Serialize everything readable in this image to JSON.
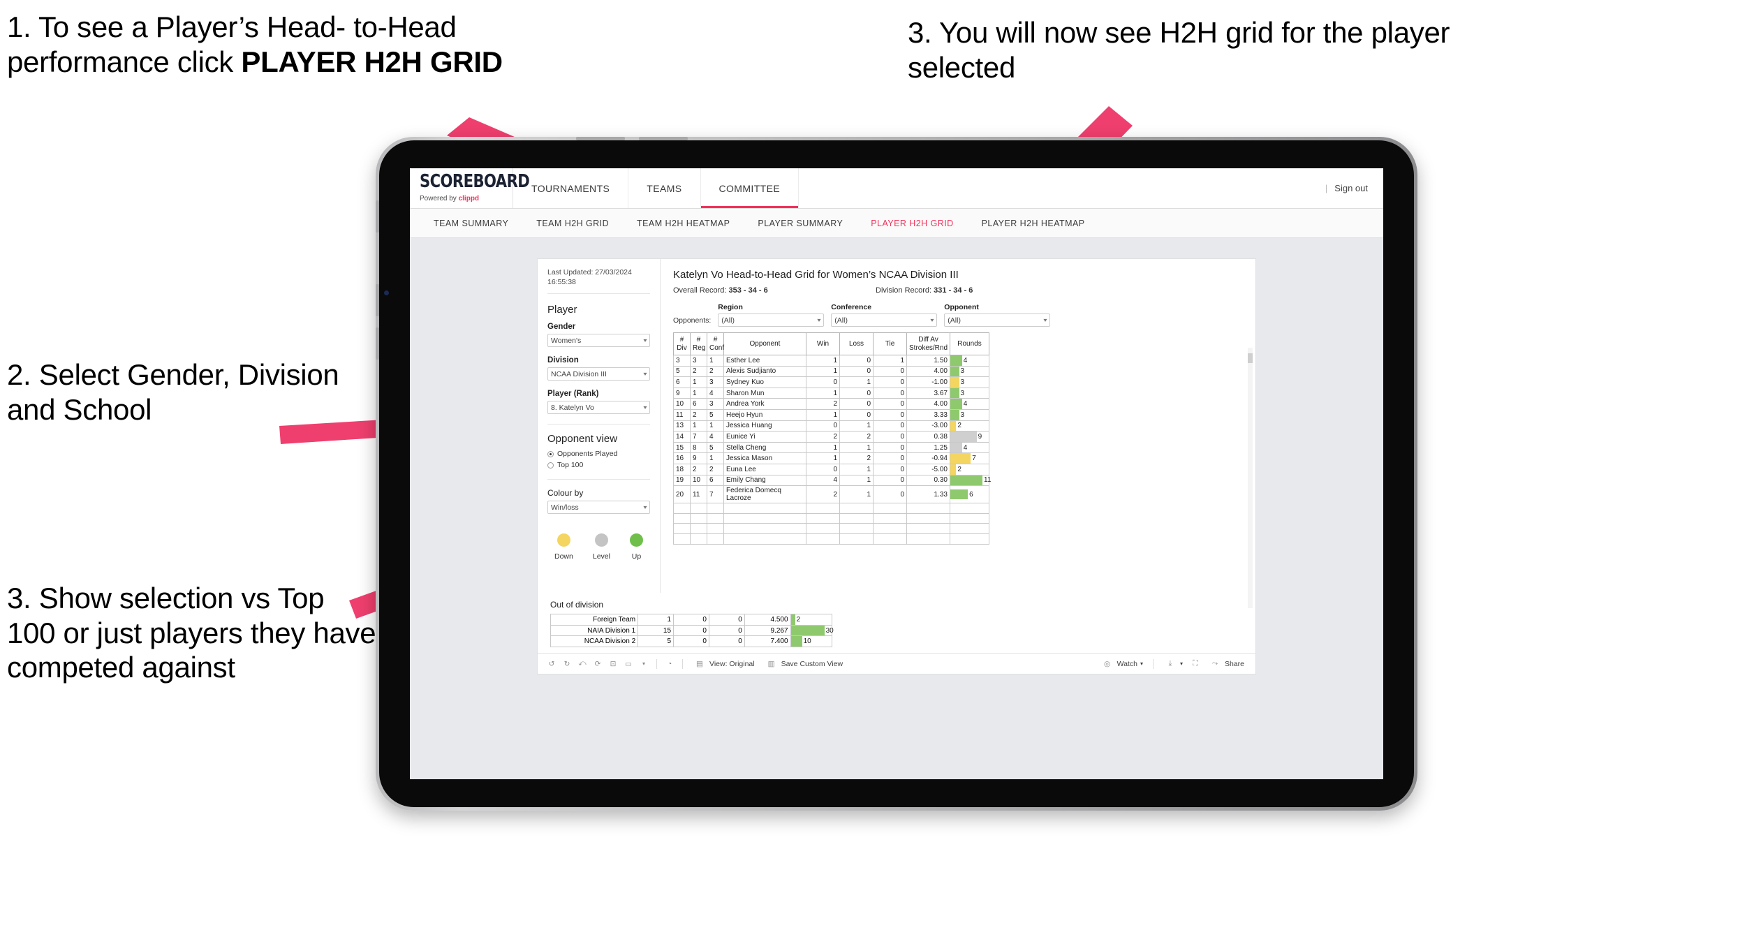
{
  "annotations": {
    "a1_line1": "1. To see a Player’s Head-",
    "a1_line2": "to-Head performance click",
    "a1_bold": "PLAYER H2H GRID",
    "a2": "2. Select Gender, Division and School",
    "a3": "3. Show selection vs Top 100 or just players they have competed against",
    "a4": "3. You will now see H2H grid for the player selected"
  },
  "app": {
    "logo_main": "SCOREBOARD",
    "logo_sub_prefix": "Powered by ",
    "logo_brand": "clippd",
    "top_nav": [
      "TOURNAMENTS",
      "TEAMS",
      "COMMITTEE"
    ],
    "header_right_sep": "|",
    "sign_out": "Sign out",
    "tabs": [
      {
        "label": "TEAM SUMMARY",
        "active": false
      },
      {
        "label": "TEAM H2H GRID",
        "active": false
      },
      {
        "label": "TEAM H2H HEATMAP",
        "active": false
      },
      {
        "label": "PLAYER SUMMARY",
        "active": false
      },
      {
        "label": "PLAYER H2H GRID",
        "active": true
      },
      {
        "label": "PLAYER H2H HEATMAP",
        "active": false
      }
    ],
    "accent_color": "#f0325c"
  },
  "sidebar": {
    "last_updated": "Last Updated: 27/03/2024 16:55:38",
    "section_player": "Player",
    "filters": [
      {
        "label": "Gender",
        "value": "Women's"
      },
      {
        "label": "Division",
        "value": "NCAA Division III"
      },
      {
        "label": "Player (Rank)",
        "value": "8. Katelyn Vo"
      }
    ],
    "opponent_view": {
      "title": "Opponent view",
      "options": [
        {
          "label": "Opponents Played",
          "selected": true
        },
        {
          "label": "Top 100",
          "selected": false
        }
      ]
    },
    "colour_by": {
      "label": "Colour by",
      "value": "Win/loss"
    },
    "legend": [
      {
        "label": "Down",
        "color": "#f3d55f"
      },
      {
        "label": "Level",
        "color": "#c4c4c4"
      },
      {
        "label": "Up",
        "color": "#6fbf4a"
      }
    ]
  },
  "viz": {
    "title": "Katelyn Vo Head-to-Head Grid for Women’s NCAA Division III",
    "overall_record_label": "Overall Record:",
    "overall_record_value": "353 -  34 - 6",
    "division_record_label": "Division Record:",
    "division_record_value": "331 -  34 - 6",
    "opponents_label": "Opponents:",
    "opponent_filters": [
      {
        "caption": "Region",
        "value": "(All)"
      },
      {
        "caption": "Conference",
        "value": "(All)"
      },
      {
        "caption": "Opponent",
        "value": "(All)"
      }
    ],
    "columns": [
      {
        "l1": "#",
        "l2": "Div"
      },
      {
        "l1": "#",
        "l2": "Reg"
      },
      {
        "l1": "#",
        "l2": "Conf"
      },
      {
        "l1": "Opponent",
        "l2": ""
      },
      {
        "l1": "Win",
        "l2": ""
      },
      {
        "l1": "Loss",
        "l2": ""
      },
      {
        "l1": "Tie",
        "l2": ""
      },
      {
        "l1": "Diff Av",
        "l2": "Strokes/Rnd"
      },
      {
        "l1": "Rounds",
        "l2": ""
      }
    ],
    "rows": [
      {
        "div": "3",
        "reg": "3",
        "conf": "1",
        "opponent": "Esther Lee",
        "win": "1",
        "loss": "0",
        "tie": "1",
        "diff": "1.50",
        "rounds": "4",
        "state": "up"
      },
      {
        "div": "5",
        "reg": "2",
        "conf": "2",
        "opponent": "Alexis Sudjianto",
        "win": "1",
        "loss": "0",
        "tie": "0",
        "diff": "4.00",
        "rounds": "3",
        "state": "up"
      },
      {
        "div": "6",
        "reg": "1",
        "conf": "3",
        "opponent": "Sydney Kuo",
        "win": "0",
        "loss": "1",
        "tie": "0",
        "diff": "-1.00",
        "rounds": "3",
        "state": "down"
      },
      {
        "div": "9",
        "reg": "1",
        "conf": "4",
        "opponent": "Sharon Mun",
        "win": "1",
        "loss": "0",
        "tie": "0",
        "diff": "3.67",
        "rounds": "3",
        "state": "up"
      },
      {
        "div": "10",
        "reg": "6",
        "conf": "3",
        "opponent": "Andrea York",
        "win": "2",
        "loss": "0",
        "tie": "0",
        "diff": "4.00",
        "rounds": "4",
        "state": "up"
      },
      {
        "div": "11",
        "reg": "2",
        "conf": "5",
        "opponent": "Heejo Hyun",
        "win": "1",
        "loss": "0",
        "tie": "0",
        "diff": "3.33",
        "rounds": "3",
        "state": "up"
      },
      {
        "div": "13",
        "reg": "1",
        "conf": "1",
        "opponent": "Jessica Huang",
        "win": "0",
        "loss": "1",
        "tie": "0",
        "diff": "-3.00",
        "rounds": "2",
        "state": "down"
      },
      {
        "div": "14",
        "reg": "7",
        "conf": "4",
        "opponent": "Eunice Yi",
        "win": "2",
        "loss": "2",
        "tie": "0",
        "diff": "0.38",
        "rounds": "9",
        "state": "level"
      },
      {
        "div": "15",
        "reg": "8",
        "conf": "5",
        "opponent": "Stella Cheng",
        "win": "1",
        "loss": "1",
        "tie": "0",
        "diff": "1.25",
        "rounds": "4",
        "state": "level"
      },
      {
        "div": "16",
        "reg": "9",
        "conf": "1",
        "opponent": "Jessica Mason",
        "win": "1",
        "loss": "2",
        "tie": "0",
        "diff": "-0.94",
        "rounds": "7",
        "state": "down"
      },
      {
        "div": "18",
        "reg": "2",
        "conf": "2",
        "opponent": "Euna Lee",
        "win": "0",
        "loss": "1",
        "tie": "0",
        "diff": "-5.00",
        "rounds": "2",
        "state": "down"
      },
      {
        "div": "19",
        "reg": "10",
        "conf": "6",
        "opponent": "Emily Chang",
        "win": "4",
        "loss": "1",
        "tie": "0",
        "diff": "0.30",
        "rounds": "11",
        "state": "up"
      },
      {
        "div": "20",
        "reg": "11",
        "conf": "7",
        "opponent": "Federica Domecq Lacroze",
        "win": "2",
        "loss": "1",
        "tie": "0",
        "diff": "1.33",
        "rounds": "6",
        "state": "up"
      }
    ],
    "out_of_division": {
      "title": "Out of division",
      "rows": [
        {
          "name": "Foreign Team",
          "win": "1",
          "loss": "0",
          "tie": "0",
          "diff": "4.500",
          "rounds": "2",
          "state": "up"
        },
        {
          "name": "NAIA Division 1",
          "win": "15",
          "loss": "0",
          "tie": "0",
          "diff": "9.267",
          "rounds": "30",
          "state": "up"
        },
        {
          "name": "NCAA Division 2",
          "win": "5",
          "loss": "0",
          "tie": "0",
          "diff": "7.400",
          "rounds": "10",
          "state": "up"
        }
      ]
    }
  },
  "toolbar": {
    "icons": [
      "undo-icon",
      "redo-icon",
      "revert-icon",
      "refresh-icon",
      "pause-icon",
      "zoom-icon",
      "alert-icon"
    ],
    "view_original": "View: Original",
    "save_custom_view": "Save Custom View",
    "watch": "Watch",
    "share": "Share"
  },
  "chart_data": {
    "type": "table",
    "title": "Katelyn Vo Head-to-Head Grid for Women’s NCAA Division III",
    "columns": [
      "# Div",
      "# Reg",
      "# Conf",
      "Opponent",
      "Win",
      "Loss",
      "Tie",
      "Diff Av Strokes/Rnd",
      "Rounds"
    ],
    "values": [
      [
        3,
        3,
        1,
        "Esther Lee",
        1,
        0,
        1,
        1.5,
        4
      ],
      [
        5,
        2,
        2,
        "Alexis Sudjianto",
        1,
        0,
        0,
        4.0,
        3
      ],
      [
        6,
        1,
        3,
        "Sydney Kuo",
        0,
        1,
        0,
        -1.0,
        3
      ],
      [
        9,
        1,
        4,
        "Sharon Mun",
        1,
        0,
        0,
        3.67,
        3
      ],
      [
        10,
        6,
        3,
        "Andrea York",
        2,
        0,
        0,
        4.0,
        4
      ],
      [
        11,
        2,
        5,
        "Heejo Hyun",
        1,
        0,
        0,
        3.33,
        3
      ],
      [
        13,
        1,
        1,
        "Jessica Huang",
        0,
        1,
        0,
        -3.0,
        2
      ],
      [
        14,
        7,
        4,
        "Eunice Yi",
        2,
        2,
        0,
        0.38,
        9
      ],
      [
        15,
        8,
        5,
        "Stella Cheng",
        1,
        1,
        0,
        1.25,
        4
      ],
      [
        16,
        9,
        1,
        "Jessica Mason",
        1,
        2,
        0,
        -0.94,
        7
      ],
      [
        18,
        2,
        2,
        "Euna Lee",
        0,
        1,
        0,
        -5.0,
        2
      ],
      [
        19,
        10,
        6,
        "Emily Chang",
        4,
        1,
        0,
        0.3,
        11
      ],
      [
        20,
        11,
        7,
        "Federica Domecq Lacroze",
        2,
        1,
        0,
        1.33,
        6
      ]
    ],
    "out_of_division": [
      [
        "Foreign Team",
        1,
        0,
        0,
        4.5,
        2
      ],
      [
        "NAIA Division 1",
        15,
        0,
        0,
        9.267,
        30
      ],
      [
        "NCAA Division 2",
        5,
        0,
        0,
        7.4,
        10
      ]
    ],
    "colour_encoding": {
      "up": "#8fc96e",
      "down": "#f3d55f",
      "level": "#cfcfcf"
    },
    "rounds_bar_max": 30
  }
}
